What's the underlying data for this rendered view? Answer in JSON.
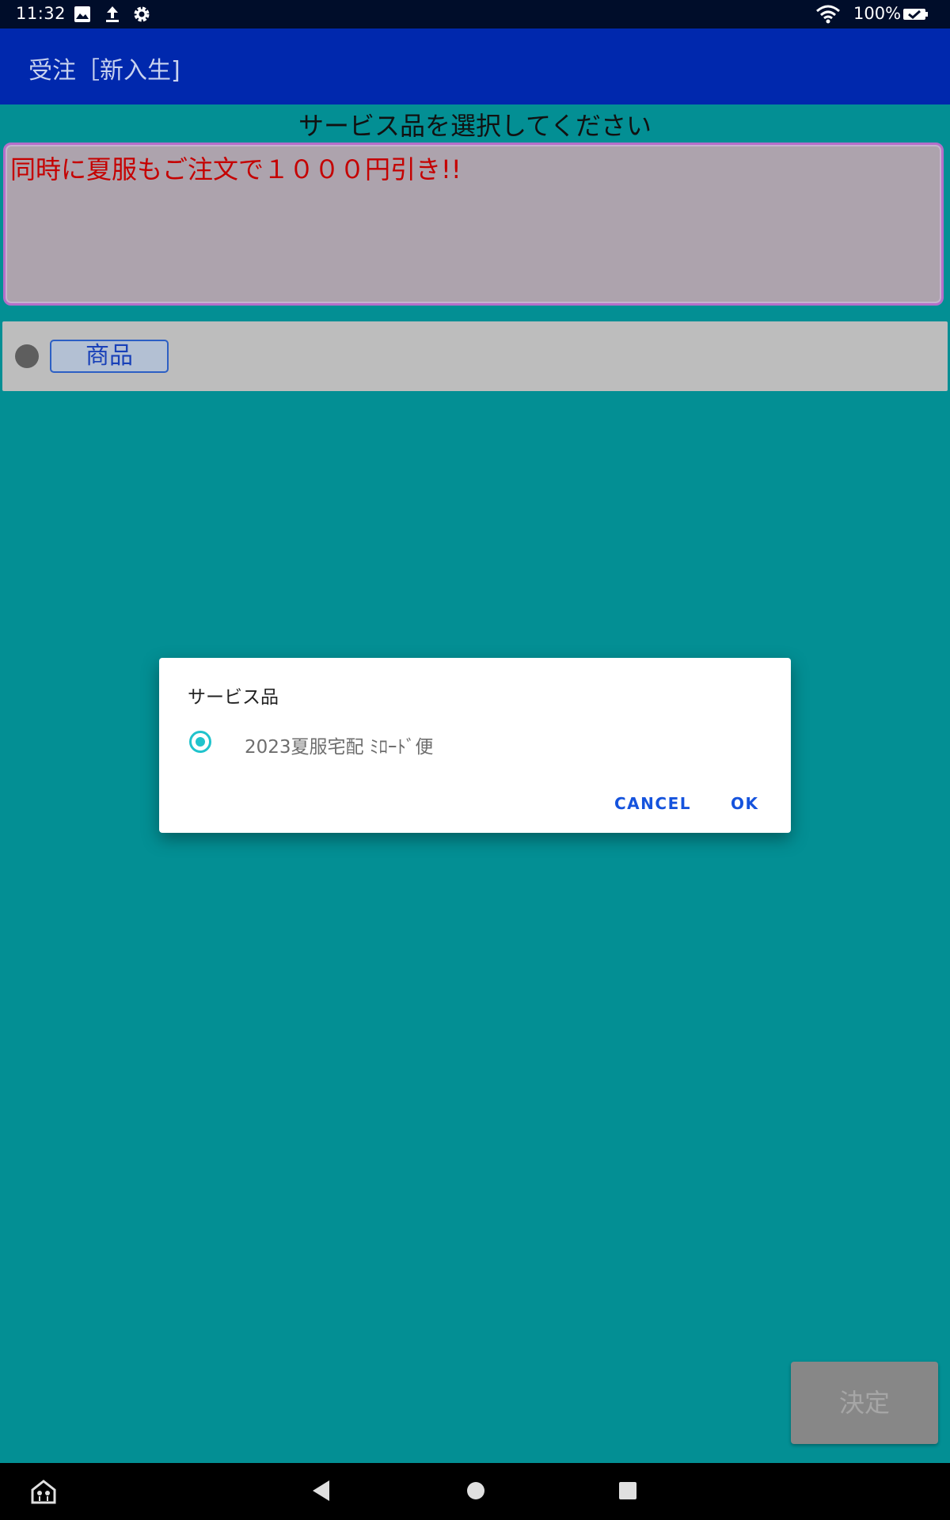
{
  "status_bar": {
    "time": "11:32",
    "battery": "100%",
    "icons": [
      "image-icon",
      "upload-icon",
      "settings-icon",
      "wifi-icon",
      "battery-charging-icon"
    ]
  },
  "app_bar": {
    "title": "受注［新入生]"
  },
  "main": {
    "prompt": "サービス品を選択してください",
    "notice": "同時に夏服もご注文で１０００円引き!!",
    "product_button": "商品",
    "confirm_button": "決定"
  },
  "dialog": {
    "title": "サービス品",
    "options": [
      {
        "label": "2023夏服宅配 ﾐﾛｰﾄﾞ便",
        "selected": true
      }
    ],
    "cancel_label": "CANCEL",
    "ok_label": "OK"
  },
  "nav_bar": {
    "icons": [
      "accessibility-icon",
      "back-icon",
      "home-icon",
      "recents-icon"
    ]
  },
  "colors": {
    "background": "#038f94",
    "app_bar": "#0028ad",
    "status_bar": "#000d2a",
    "notice_text": "#c50000",
    "dialog_accent": "#20c3cc",
    "dialog_button": "#1553dd"
  }
}
